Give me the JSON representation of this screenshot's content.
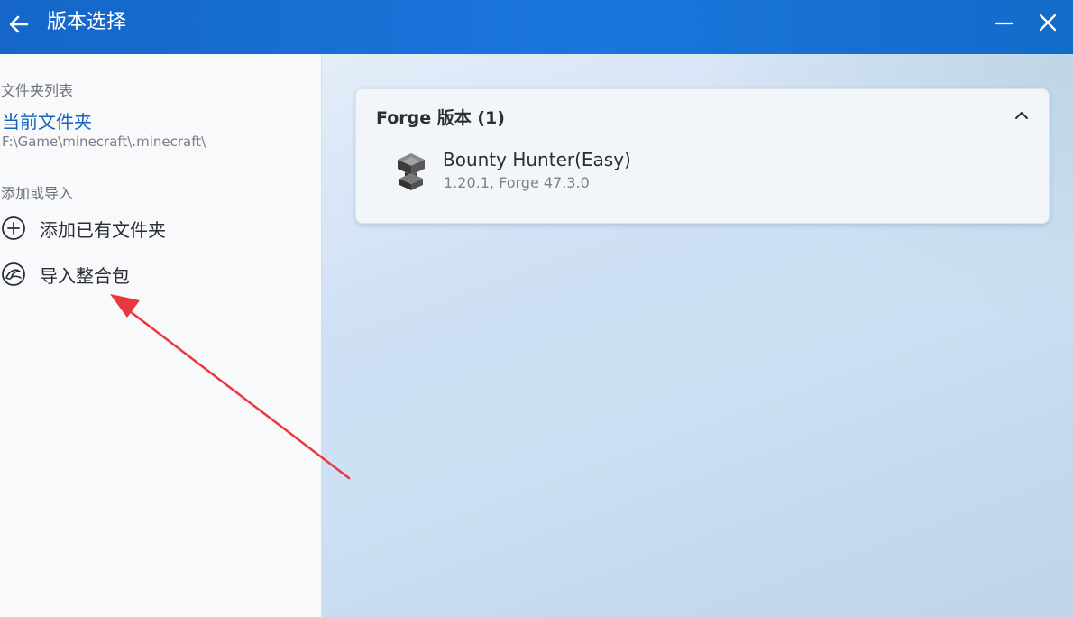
{
  "window": {
    "title": "版本选择",
    "accent_color": "#1a72d6",
    "icons": {
      "back": "arrow-left-icon",
      "minimize": "minimize-icon",
      "close": "close-icon"
    }
  },
  "sidebar": {
    "folders_section_label": "文件夹列表",
    "current_folder": {
      "name": "当前文件夹",
      "path": "F:\\Game\\minecraft\\.minecraft\\"
    },
    "add_section_label": "添加或导入",
    "items": [
      {
        "label": "添加已有文件夹",
        "icon": "add-circle-icon"
      },
      {
        "label": "导入整合包",
        "icon": "import-package-icon"
      }
    ]
  },
  "main": {
    "group": {
      "title": "Forge 版本 (1)",
      "expanded": true,
      "versions": [
        {
          "name": "Bounty Hunter(Easy)",
          "details": "1.20.1, Forge 47.3.0",
          "icon": "anvil-icon"
        }
      ]
    }
  },
  "annotation": {
    "type": "arrow",
    "color": "#e8383d",
    "points_to": "导入整合包"
  }
}
